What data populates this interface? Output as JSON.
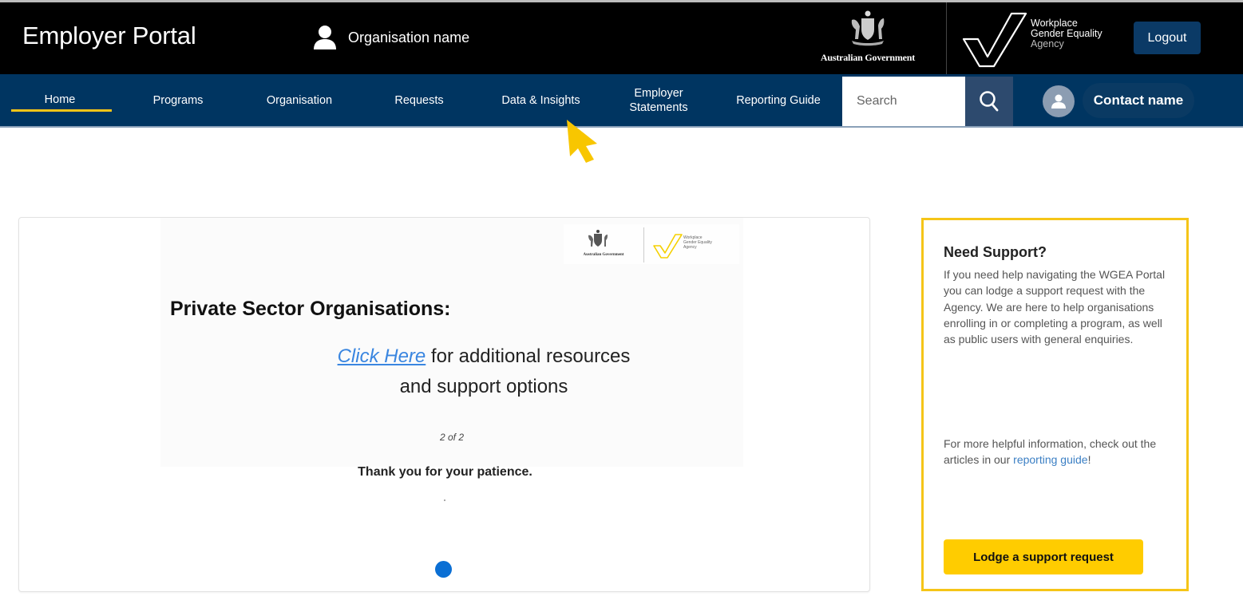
{
  "header": {
    "title": "Employer Portal",
    "org_icon": "person-icon",
    "org_name": "Organisation name",
    "gov_logo_text": "Australian Government",
    "agency_logo": {
      "line1": "Workplace",
      "line2": "Gender Equality",
      "line3": "Agency"
    },
    "logout_label": "Logout"
  },
  "nav": {
    "items": [
      {
        "label": "Home",
        "active": true
      },
      {
        "label": "Programs"
      },
      {
        "label": "Organisation"
      },
      {
        "label": "Requests"
      },
      {
        "label": "Data & Insights"
      },
      {
        "label": "Employer Statements",
        "line1": "Employer",
        "line2": "Statements"
      },
      {
        "label": "Reporting Guide"
      }
    ],
    "search_placeholder": "Search",
    "search_icon": "search-icon",
    "contact_icon": "user-avatar-icon",
    "contact_name": "Contact name",
    "accent_color": "#f5c518"
  },
  "carousel": {
    "slide": {
      "logo_gov": "Australian Government",
      "logo_agency": [
        "Workplace",
        "Gender Equality",
        "Agency"
      ],
      "heading": "Private Sector Organisations:",
      "link_text": "Click Here",
      "line1_rest": " for additional resources",
      "line2": "and support options",
      "counter": "2 of 2"
    },
    "footer_text": "Thank you for your patience.",
    "active_dot_color": "#0b6fd4",
    "current_slide": 2,
    "total_slides": 2
  },
  "support": {
    "title": "Need Support?",
    "paragraph1": "If you need help navigating the WGEA Portal you can lodge a support request with the Agency. We are here to help organisations enrolling in or completing a program, as well as public users with general enquiries.",
    "paragraph2_prefix": "For more helpful information, check out the articles in our ",
    "paragraph2_link": "reporting guide",
    "paragraph2_suffix": "!",
    "button_label": "Lodge a support request",
    "border_color": "#f5c518",
    "button_color": "#ffcc00"
  }
}
